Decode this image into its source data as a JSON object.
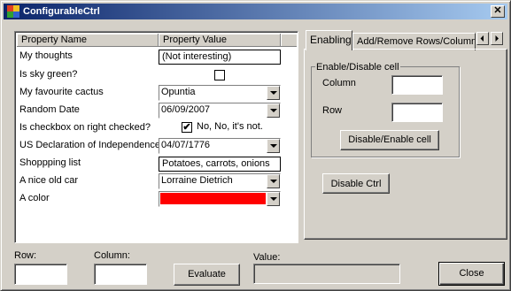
{
  "window": {
    "title": "ConfigurableCtrl",
    "close_glyph": "✕"
  },
  "grid": {
    "col_name": "Property Name",
    "col_value": "Property Value",
    "rows": [
      {
        "name": "My thoughts",
        "value": "(Not interesting)",
        "kind": "text"
      },
      {
        "name": "Is sky green?",
        "value": "",
        "kind": "checkbox",
        "checked": false
      },
      {
        "name": "My favourite cactus",
        "value": "Opuntia",
        "kind": "combo"
      },
      {
        "name": "Random Date",
        "value": "06/09/2007",
        "kind": "combo"
      },
      {
        "name": "Is checkbox on right checked?",
        "value": "No, No, it's not.",
        "kind": "checkbox",
        "checked": true,
        "check_glyph": "✔"
      },
      {
        "name": "US Declaration of Independence",
        "value": "04/07/1776",
        "kind": "combo"
      },
      {
        "name": "Shoppping list",
        "value": "Potatoes, carrots, onions",
        "kind": "text"
      },
      {
        "name": "A nice old car",
        "value": "Lorraine Dietrich",
        "kind": "combo"
      },
      {
        "name": "A color",
        "value": "",
        "kind": "color",
        "color": "#ff0000"
      }
    ]
  },
  "tabs": {
    "items": [
      "Enabling",
      "Add/Remove Rows/Columns"
    ],
    "active": 0
  },
  "enabling": {
    "group_label": "Enable/Disable cell",
    "column_label": "Column",
    "row_label": "Row",
    "toggle_cell_button": "Disable/Enable cell",
    "disable_ctrl_button": "Disable Ctrl"
  },
  "bottom": {
    "row_label": "Row:",
    "column_label": "Column:",
    "evaluate_button": "Evaluate",
    "value_label": "Value:",
    "close_button": "Close"
  },
  "colors": {
    "title_start": "#0a246a",
    "title_end": "#a6caf0",
    "face": "#d4d0c8"
  }
}
